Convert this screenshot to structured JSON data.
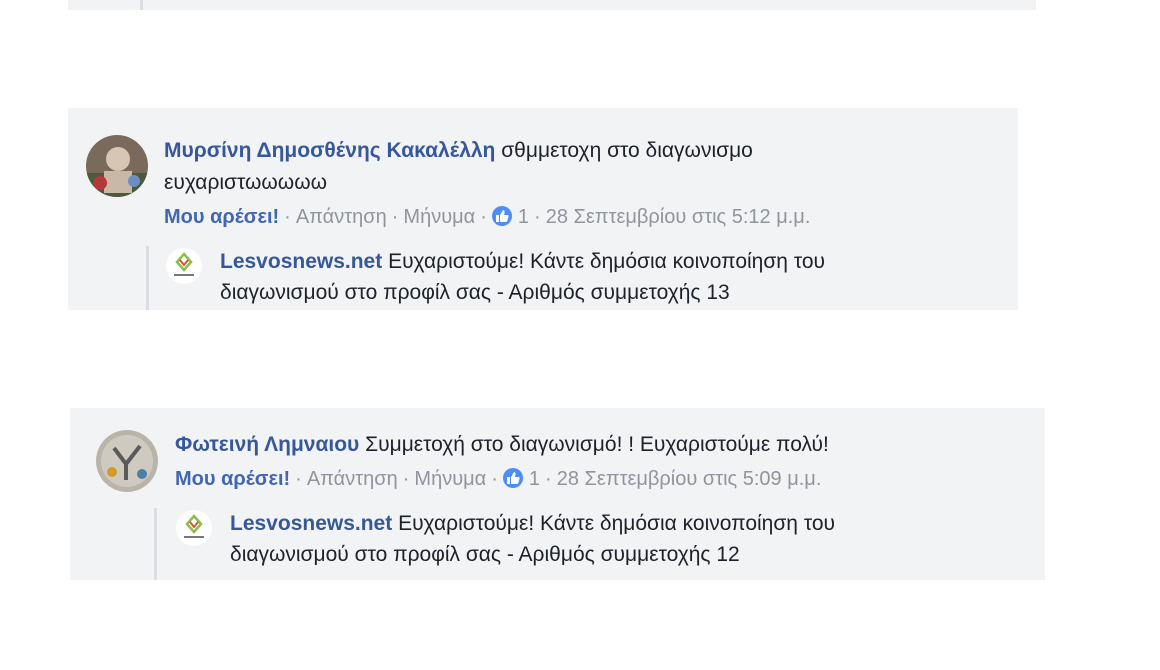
{
  "comments": [
    {
      "author": "Μυρσίνη Δημοσθένης Κακαλέλλη",
      "text_line1": " σθμμετοχη στο διαγωνισμο",
      "text_line2": "ευχαριστωωωωω",
      "like_label": "Μου αρέσει!",
      "reply_label": "Απάντηση",
      "message_label": "Μήνυμα",
      "like_count": "1",
      "timestamp": "28 Σεπτεμβρίου στις 5:12 μ.μ.",
      "reply": {
        "author": "Lesvosnews.net",
        "text_line1": " Ευχαριστούμε! Κάντε δημόσια κοινοποίηση του",
        "text_line2": "διαγωνισμού στο προφίλ σας - Αριθμός συμμετοχής 13"
      }
    },
    {
      "author": "Φωτεινή Λημναιου",
      "text_line1": " Συμμετοχή στο διαγωνισμό! ! Ευχαριστούμε πολύ!",
      "like_label": "Μου αρέσει!",
      "reply_label": "Απάντηση",
      "message_label": "Μήνυμα",
      "like_count": "1",
      "timestamp": "28 Σεπτεμβρίου στις 5:09 μ.μ.",
      "reply": {
        "author": "Lesvosnews.net",
        "text_line1": " Ευχαριστούμε! Κάντε δημόσια κοινοποίηση του",
        "text_line2": "διαγωνισμού στο προφίλ σας - Αριθμός συμμετοχής 12"
      }
    }
  ],
  "separator": "·",
  "icons": {
    "like_reaction": "thumbs-up-icon",
    "avatar_1": "avatar",
    "avatar_2": "avatar",
    "page_logo": "lesvosnews-logo"
  },
  "colors": {
    "author": "#365899",
    "like": "#4267b2",
    "meta": "#90949c",
    "panel": "#f2f3f5",
    "reaction": "#4e8cf7"
  }
}
